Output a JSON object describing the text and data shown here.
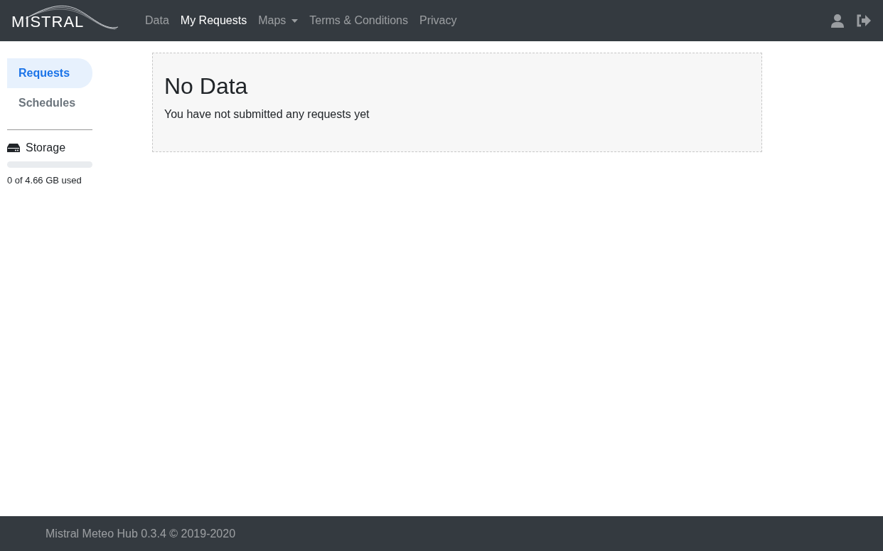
{
  "navbar": {
    "logo_text": "MISTRAL",
    "items": [
      {
        "label": "Data",
        "selected": false,
        "kind": "link"
      },
      {
        "label": "My Requests",
        "selected": true,
        "kind": "link"
      },
      {
        "label": "Maps",
        "selected": false,
        "kind": "dropdown"
      },
      {
        "label": "Terms & Conditions",
        "selected": false,
        "kind": "link"
      },
      {
        "label": "Privacy",
        "selected": false,
        "kind": "link"
      }
    ]
  },
  "sidebar": {
    "items": [
      {
        "label": "Requests",
        "selected": true
      },
      {
        "label": "Schedules",
        "selected": false
      }
    ],
    "storage": {
      "label": "Storage",
      "level": 0,
      "reading": "0 of 4.66 GB used"
    }
  },
  "main": {
    "title": "No Data",
    "message": "You have not submitted any requests yet"
  },
  "footer": {
    "text": "Mistral Meteo Hub 0.3.4 © 2019-2020"
  }
}
